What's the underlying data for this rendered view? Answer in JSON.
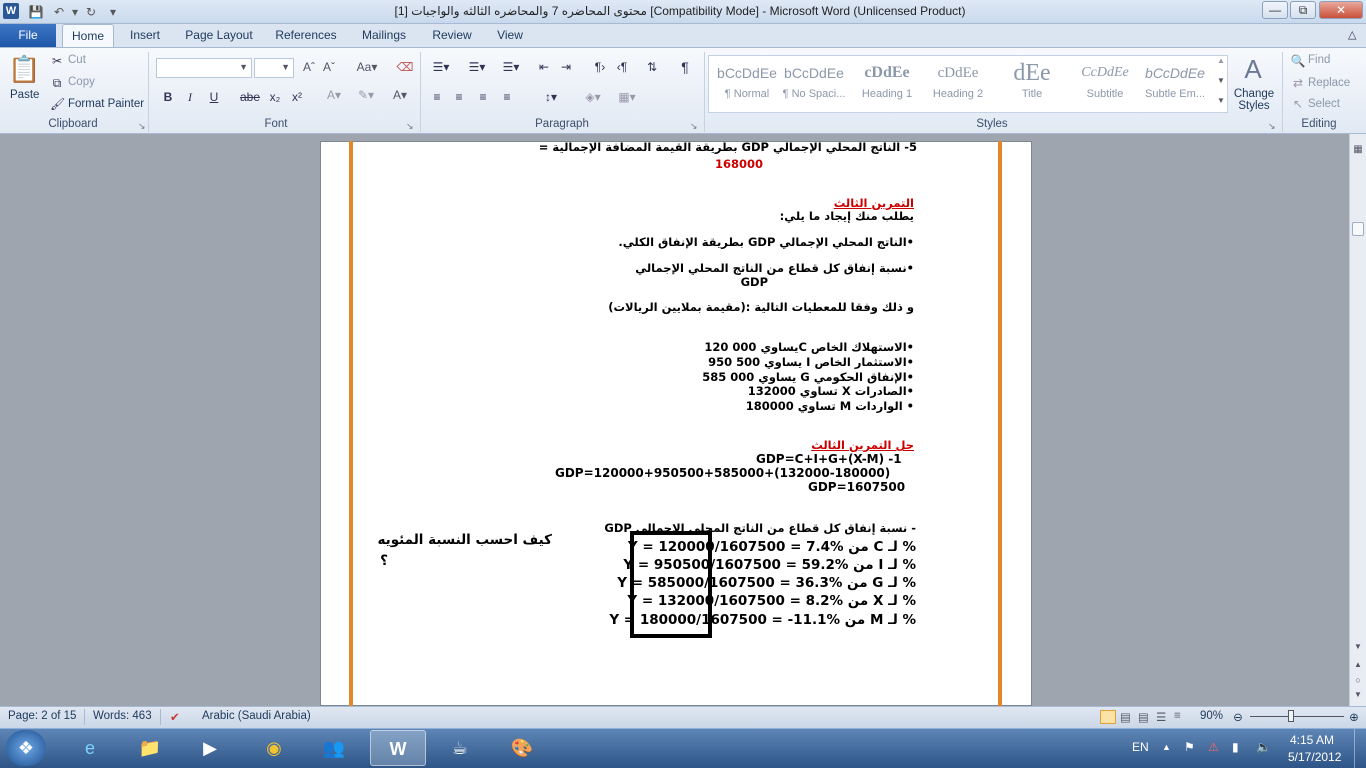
{
  "window": {
    "title": "محتوى المحاضره 7 والمحاضره الثالثه والواجبات [1] [Compatibility Mode]  -  Microsoft Word (Unlicensed Product)",
    "minimize_icon": "minimize-icon",
    "maximize_icon": "restore-icon",
    "close_icon": "close-icon"
  },
  "tabs": [
    "File",
    "Home",
    "Insert",
    "Page Layout",
    "References",
    "Mailings",
    "Review",
    "View"
  ],
  "ribbon": {
    "clipboard": {
      "paste": "Paste",
      "cut": "Cut",
      "copy": "Copy",
      "format_painter": "Format Painter",
      "label": "Clipboard"
    },
    "font": {
      "label": "Font",
      "bold": "B",
      "italic": "I",
      "underline": "U",
      "strike": "abe",
      "subscript": "x₂",
      "superscript": "x²"
    },
    "paragraph": {
      "label": "Paragraph",
      "pilcrow": "¶"
    },
    "styles": {
      "label": "Styles",
      "items": [
        {
          "sample": "bCcDdEe",
          "name": "¶ Normal"
        },
        {
          "sample": "bCcDdEe",
          "name": "¶ No Spaci..."
        },
        {
          "sample": "cDdEe",
          "name": "Heading 1"
        },
        {
          "sample": "cDdEe",
          "name": "Heading 2"
        },
        {
          "sample": "dEe",
          "name": "Title"
        },
        {
          "sample": "CcDdEe",
          "name": "Subtitle"
        },
        {
          "sample": "bCcDdEe",
          "name": "Subtle Em..."
        }
      ],
      "change_styles": "Change Styles"
    },
    "editing": {
      "label": "Editing",
      "find": "Find",
      "replace": "Replace",
      "select": "Select"
    }
  },
  "document": {
    "line1": "5- الناتج المحلي الإجمالي GDP بطريقة  القيمة المضافة الإجمالية =",
    "line1_value": "168000",
    "ex3_title": "التمرين الثالث",
    "ex3_ask": "يطلب منك إيجاد ما يلي:",
    "ex3_item1": "•الناتج المحلي الإجمالي  GDP بطريقة الإنفاق الكلي.",
    "ex3_item2a": "•نسبة إنفاق كل قطاع من الناتج المحلي الإجمالي",
    "ex3_item2b": "GDP",
    "ex3_data_intro": "و ذلك وفقا للمعطيات التالية :(مقيمة بملايين الريالات)",
    "data": [
      "•الاستهلاك الخاص   Cيساوي 000 120",
      "•الاستثمار الخاص  I  يساوي  500 950",
      "•الإنفاق الحكومي  G يساوي  000 585",
      "•الصادرات  X   تساوي 132000",
      "• الواردات  M   تساوي 180000"
    ],
    "sol_title": "حل التمرين الثالث",
    "sol1": "GDP=C+I+G+(X-M)  -1",
    "sol2": "GDP=120000+950500+585000+(132000-180000)",
    "sol3": "GDP=1607500",
    "share_title": "- نسبة إنفاق كل قطاع من الناتج المحلي الإجمالي  GDP",
    "shares": [
      "% لـ C من Y = 120000/1607500 = 7.4%",
      "% لـ I من Y = 950500/1607500 = 59.2%",
      "% لـ G من Y = 585000/1607500 = 36.3%",
      "% لـ X من Y = 132000/1607500 = 8.2%",
      "% لـ M من Y = 180000/1607500 = -11.1%"
    ],
    "question_line1": "كيف احسب النسبة المئويه",
    "question_line2": "؟"
  },
  "status": {
    "page": "Page: 2 of 15",
    "words": "Words: 463",
    "language": "Arabic (Saudi Arabia)",
    "zoom": "90%"
  },
  "taskbar": {
    "lang": "EN",
    "time": "4:15 AM",
    "date": "5/17/2012"
  }
}
